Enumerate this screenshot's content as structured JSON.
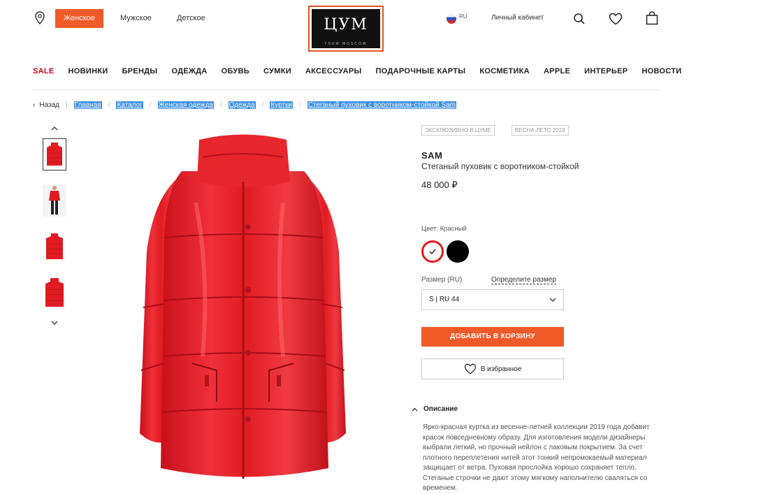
{
  "header": {
    "gender_tabs": [
      {
        "label": "Женское",
        "active": true
      },
      {
        "label": "Мужское",
        "active": false
      },
      {
        "label": "Детское",
        "active": false
      }
    ],
    "logo_text": "ЦУМ",
    "logo_subtext": "TSUM MOSCOW",
    "region": "RU",
    "account_label": "Личный кабинет",
    "icons": [
      "location-icon",
      "search-icon",
      "heart-icon",
      "bag-icon"
    ]
  },
  "nav": {
    "items": [
      "SALE",
      "НОВИНКИ",
      "БРЕНДЫ",
      "ОДЕЖДА",
      "ОБУВЬ",
      "СУМКИ",
      "АКСЕССУАРЫ",
      "ПОДАРОЧНЫЕ КАРТЫ",
      "КОСМЕТИКА",
      "APPLE",
      "ИНТЕРЬЕР",
      "НОВОСТИ"
    ],
    "sale_color": "#d0021b"
  },
  "breadcrumb": {
    "back_label": "Назад",
    "items": [
      "Главная",
      "Каталог",
      "Женская одежда",
      "Одежда",
      "Куртки",
      "Стеганый пуховик с воротником-стойкой Sam"
    ]
  },
  "product": {
    "tags": [
      "ЭКСКЛЮЗИВНО В ЦУМЕ",
      "ВЕСНА-ЛЕТО 2019"
    ],
    "brand": "SAM",
    "name": "Стеганый пуховик с воротником-стойкой",
    "price": "48 000 ₽",
    "color_label": "Цвет: Красный",
    "colors": [
      {
        "name": "red",
        "hex": "#e11b22",
        "selected": true
      },
      {
        "name": "black",
        "hex": "#000000",
        "selected": false
      }
    ],
    "size_label": "Размер (RU)",
    "size_link": "Определите размер",
    "size_value": "S | RU 44",
    "add_to_cart": "ДОБАВИТЬ В КОРЗИНУ",
    "favorite": "В избранное",
    "description_title": "Описание",
    "description": "Ярко-красная куртка из весенне-летней коллекции 2019 года добавит красок повседневному образу. Для изготовления модели дизайнеры выбрали легкий, но прочный нейлон с лаковым покрытием. За счет плотного переплетения нитей этот тонкий непромокаемый материал защищает от ветра. Пуховая прослойка хорошо сохраняет тепло. Стеганые строчки не дают этому мягкому наполнителю сваляться со временем."
  },
  "colors": {
    "accent": "#f05a28",
    "highlight": "#3a8ee6",
    "jacket": "#e11b22"
  }
}
